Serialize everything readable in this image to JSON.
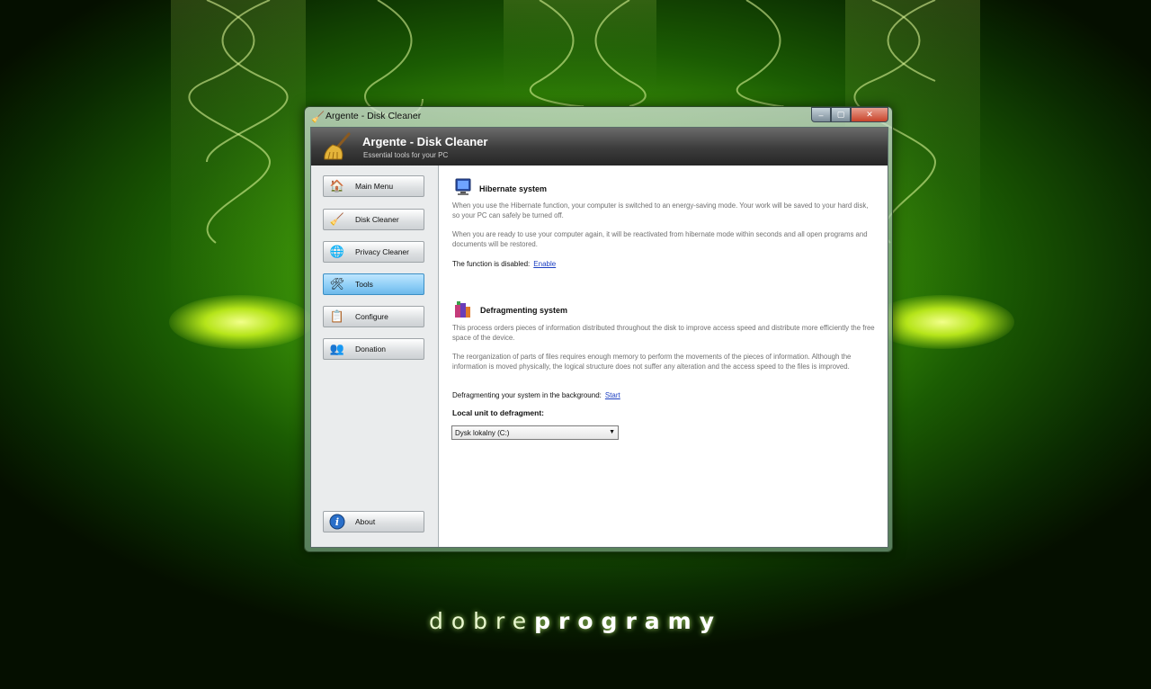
{
  "window": {
    "title": "Argente - Disk Cleaner",
    "controls": {
      "minimize": "‒",
      "maximize": "▢",
      "close": "✕"
    }
  },
  "header": {
    "title": "Argente - Disk Cleaner",
    "subtitle": "Essential tools for your PC"
  },
  "sidebar": {
    "items": [
      {
        "label": "Main Menu",
        "icon": "house-icon",
        "active": false
      },
      {
        "label": "Disk Cleaner",
        "icon": "broom-icon",
        "active": false
      },
      {
        "label": "Privacy Cleaner",
        "icon": "privacy-icon",
        "active": false
      },
      {
        "label": "Tools",
        "icon": "tools-icon",
        "active": true
      },
      {
        "label": "Configure",
        "icon": "configure-icon",
        "active": false
      },
      {
        "label": "Donation",
        "icon": "donation-icon",
        "active": false
      }
    ],
    "about": {
      "label": "About",
      "icon": "info-icon"
    }
  },
  "hibernate": {
    "title": "Hibernate system",
    "para1": "When you use the Hibernate function, your computer is switched to an energy-saving mode. Your work will be saved to your hard disk, so your PC can safely be turned off.",
    "para2": "When you are ready to use your computer again, it will be reactivated from hibernate mode within seconds and all open programs and documents will be restored.",
    "status": "The function is disabled:",
    "action": "Enable"
  },
  "defrag": {
    "title": "Defragmenting system",
    "para1": "This process orders pieces of information distributed throughout the disk to improve access speed and distribute more efficiently the free space of the device.",
    "para2": "The reorganization of parts of files requires enough memory to perform the movements of the pieces of information. Although the information is moved physically, the logical structure does not suffer any alteration and the access speed to the files is improved.",
    "status": "Defragmenting your system in the background:",
    "action": "Start",
    "unit_label": "Local unit to defragment:",
    "unit_selected": "Dysk lokalny (C:)"
  },
  "branding": {
    "light": "dobre",
    "bold": "programy"
  },
  "colors": {
    "accent": "#1c3fc2",
    "active_nav": "#8ccdf6",
    "wallpaper_green": "#3f9a08"
  }
}
